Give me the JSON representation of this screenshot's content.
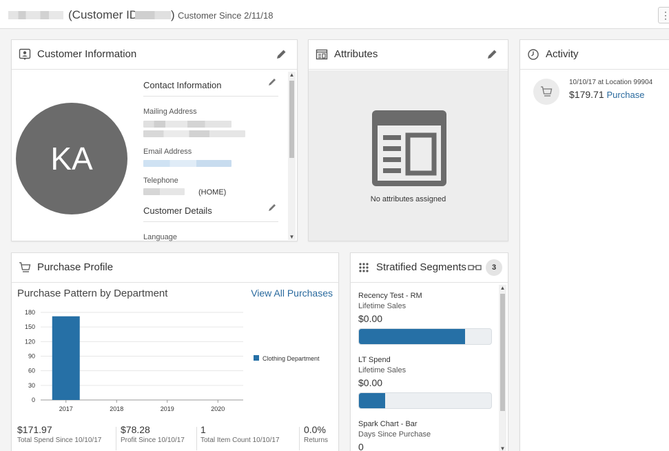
{
  "header": {
    "customer_id_prefix": "(Customer ID",
    "customer_id_suffix": ")",
    "customer_since": "Customer Since 2/11/18",
    "menu_icon": "kebab-icon"
  },
  "customer_information": {
    "title": "Customer Information",
    "avatar_initials": "KA",
    "contact_title": "Contact Information",
    "mailing_label": "Mailing Address",
    "email_label": "Email Address",
    "telephone_label": "Telephone",
    "telephone_type": "(HOME)",
    "details_title": "Customer Details",
    "language_label": "Language"
  },
  "attributes": {
    "title": "Attributes",
    "empty_text": "No attributes assigned"
  },
  "activity": {
    "title": "Activity",
    "items": [
      {
        "date_location": "10/10/17 at Location 99904",
        "amount": "$179.71",
        "type": "Purchase"
      }
    ]
  },
  "purchase_profile": {
    "title": "Purchase Profile",
    "subtitle": "Purchase Pattern by Department",
    "view_all": "View All Purchases",
    "stats": [
      {
        "value": "$171.97",
        "label": "Total Spend Since 10/10/17"
      },
      {
        "value": "$78.28",
        "label": "Profit Since 10/10/17"
      },
      {
        "value": "1",
        "label": "Total Item Count 10/10/17"
      },
      {
        "value": "0.0%",
        "label": "Returns"
      }
    ]
  },
  "chart_data": {
    "type": "bar",
    "categories": [
      "2017",
      "2018",
      "2019",
      "2020"
    ],
    "series": [
      {
        "name": "Clothing Department",
        "values": [
          172,
          0,
          0,
          0
        ]
      }
    ],
    "yticks": [
      "0",
      "30",
      "60",
      "90",
      "120",
      "150",
      "180"
    ],
    "ylim": [
      0,
      180
    ],
    "grid": true,
    "legend": "right",
    "color": "#2670a6"
  },
  "stratified_segments": {
    "title": "Stratified Segments",
    "count": "3",
    "segments": [
      {
        "name": "Recency Test - RM",
        "metric": "Lifetime Sales",
        "value": "$0.00",
        "fill": 0.8
      },
      {
        "name": "LT Spend",
        "metric": "Lifetime Sales",
        "value": "$0.00",
        "fill": 0.2
      },
      {
        "name": "Spark Chart - Bar",
        "metric": "Days Since Purchase",
        "value": "0",
        "fill": null
      }
    ]
  }
}
